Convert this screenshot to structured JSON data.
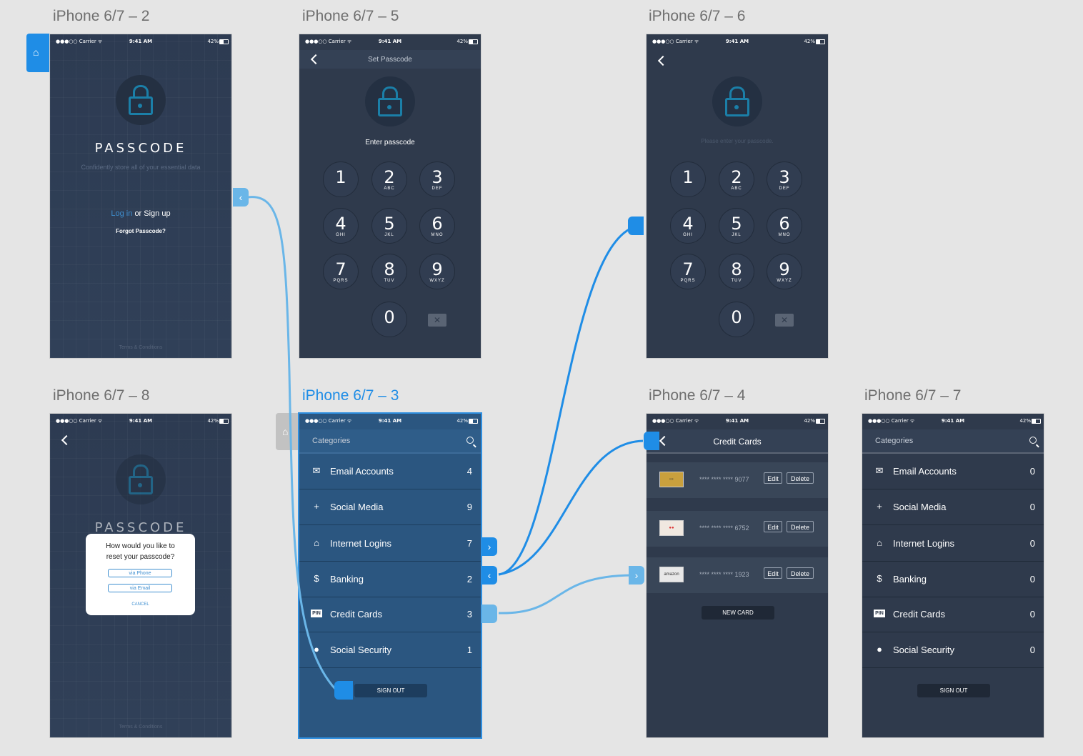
{
  "artboards": {
    "a2": "iPhone 6/7 – 2",
    "a5": "iPhone 6/7 – 5",
    "a6": "iPhone 6/7 – 6",
    "a8": "iPhone 6/7 – 8",
    "a3": "iPhone 6/7 – 3",
    "a4": "iPhone 6/7 – 4",
    "a7": "iPhone 6/7 – 7"
  },
  "status": {
    "carrier": "●●●○○ Carrier ᯤ",
    "time": "9:41 AM",
    "battery": "42%"
  },
  "login": {
    "title": "PASSCODE",
    "tagline": "Confidently store all of your essential data",
    "login_link": "Log in",
    "or_signup": "or Sign up",
    "forgot": "Forgot Passcode?",
    "terms": "Terms & Conditions"
  },
  "set_passcode": {
    "nav_title": "Set Passcode",
    "prompt": "Enter passcode"
  },
  "enter_passcode": {
    "prompt": "Please enter your passcode."
  },
  "keypad": [
    {
      "digit": "1",
      "letters": ""
    },
    {
      "digit": "2",
      "letters": "ABC"
    },
    {
      "digit": "3",
      "letters": "DEF"
    },
    {
      "digit": "4",
      "letters": "GHI"
    },
    {
      "digit": "5",
      "letters": "JKL"
    },
    {
      "digit": "6",
      "letters": "MNO"
    },
    {
      "digit": "7",
      "letters": "PQRS"
    },
    {
      "digit": "8",
      "letters": "TUV"
    },
    {
      "digit": "9",
      "letters": "WXYZ"
    },
    {
      "digit": "0",
      "letters": ""
    }
  ],
  "delete_glyph": "✕",
  "reset_modal": {
    "question_line1": "How would you like to",
    "question_line2": "reset your passcode?",
    "via_phone": "via Phone",
    "via_email": "via Email",
    "cancel": "CANCEL"
  },
  "categories": {
    "title": "Categories",
    "items": [
      {
        "label": "Email Accounts",
        "icon": "envelope-icon",
        "glyph": "✉",
        "count": "4"
      },
      {
        "label": "Social Media",
        "icon": "add-person-icon",
        "glyph": "+",
        "count": "9"
      },
      {
        "label": "Internet Logins",
        "icon": "home-icon",
        "glyph": "⌂",
        "count": "7"
      },
      {
        "label": "Banking",
        "icon": "dollar-icon",
        "glyph": "$",
        "count": "2"
      },
      {
        "label": "Credit Cards",
        "icon": "pin-icon",
        "glyph": "PIN",
        "count": "3"
      },
      {
        "label": "Social Security",
        "icon": "account-icon",
        "glyph": "●",
        "count": "1"
      }
    ],
    "signout": "SIGN OUT"
  },
  "categories_empty": {
    "counts": [
      "0",
      "0",
      "0",
      "0",
      "0",
      "0"
    ]
  },
  "credit_cards": {
    "nav_title": "Credit Cards",
    "cards": [
      {
        "number": "**** **** **** 9077",
        "brand": "amex-gold"
      },
      {
        "number": "**** **** **** 6752",
        "brand": "mastercard"
      },
      {
        "number": "**** **** **** 1923",
        "brand": "amazon"
      }
    ],
    "edit": "Edit",
    "delete": "Delete",
    "new_card": "NEW CARD"
  },
  "colors": {
    "accent": "#1f8de6",
    "phone_bg": "#2f3a4c",
    "selected_bg": "#2b5680"
  }
}
